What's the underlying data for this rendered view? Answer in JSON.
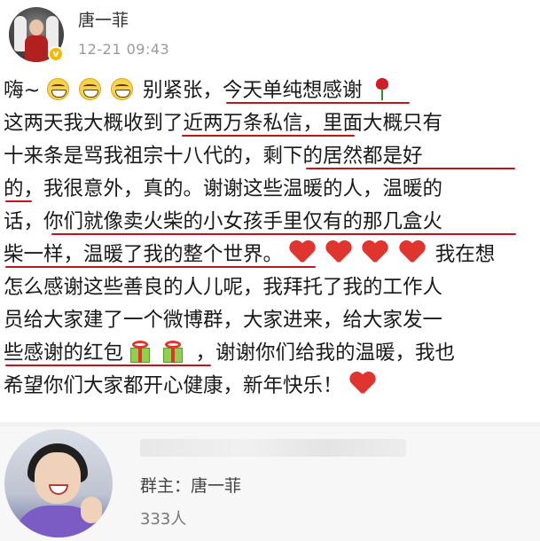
{
  "post_header": {
    "username": "唐一菲",
    "timestamp": "12-21 09:43",
    "verified_badge": "v"
  },
  "post_body": {
    "lines": [
      {
        "segments": [
          "嗨~",
          "别紧张，今天单纯想感谢"
        ]
      },
      {
        "segments": [
          "这两天我大概收到了近两万条私信，里面大概只有"
        ]
      },
      {
        "segments": [
          "十来条是骂我祖宗十八代的，剩下的居然都是好"
        ]
      },
      {
        "segments": [
          "的，我很意外，真的。谢谢这些温暖的人，温暖的"
        ]
      },
      {
        "segments": [
          "话，你们就像卖火柴的小女孩手里仅有的那几盒火"
        ]
      },
      {
        "segments": [
          "柴一样，温暖了我的整个世界。",
          "我在想"
        ]
      },
      {
        "segments": [
          "怎么感谢这些善良的人儿呢，我拜托了我的工作人"
        ]
      },
      {
        "segments": [
          "员给大家建了一个微博群，大家进来，给大家发一"
        ]
      },
      {
        "segments": [
          "些感谢的红包",
          "，谢谢你们给我的温暖，我也"
        ]
      },
      {
        "segments": [
          "希望你们大家都开心健康，新年快乐！"
        ]
      }
    ],
    "emoji_names": [
      "grin-emoji",
      "rose-emoji",
      "heart-emoji",
      "gift-emoji"
    ],
    "underline_color": "#c0141e"
  },
  "group_card": {
    "owner_label": "群主：唐一菲",
    "member_count": "333人"
  }
}
